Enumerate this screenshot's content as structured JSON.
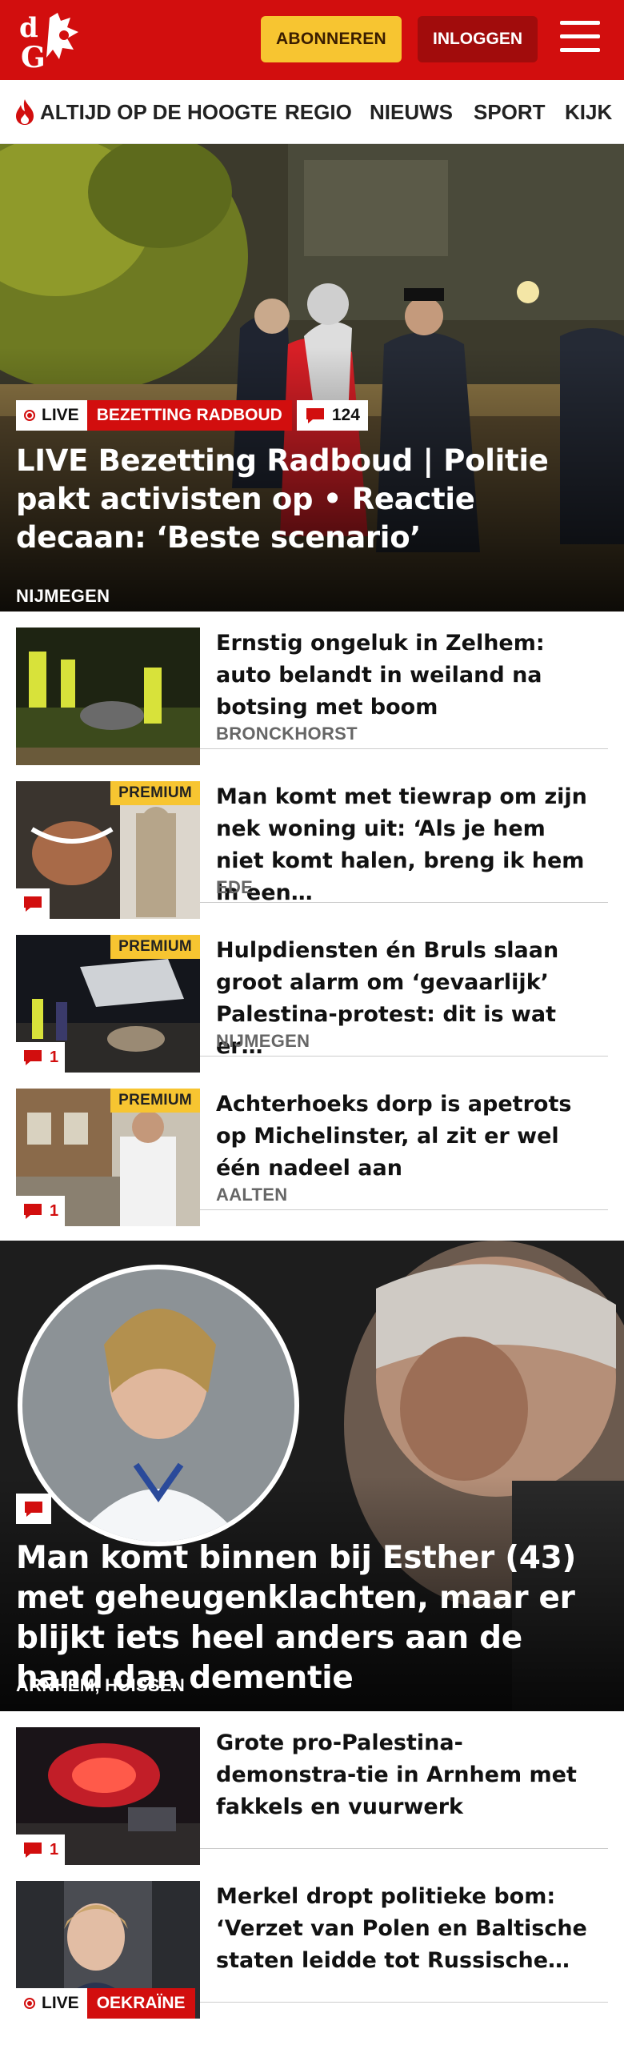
{
  "header": {
    "logo_text": "dG",
    "subscribe_label": "ABONNEREN",
    "login_label": "INLOGGEN",
    "menu_icon": "hamburger-icon"
  },
  "nav": {
    "items": [
      "ALTIJD OP DE HOOGTE",
      "REGIO",
      "NIEUWS",
      "SPORT",
      "KIJK"
    ]
  },
  "hero": {
    "live_label": "LIVE",
    "tag": "BEZETTING RADBOUD",
    "comment_count": "124",
    "title": "LIVE Bezetting Radboud | Politie pakt activisten op • Reactie decaan: ‘Beste scenario’",
    "location": "NIJMEGEN"
  },
  "articles": [
    {
      "title": "Ernstig ongeluk in Zelhem: auto belandt in weiland na botsing met boom",
      "location": "BRONCKHORST",
      "premium": "",
      "comments": ""
    },
    {
      "title": "Man komt met tiewrap om zijn nek woning uit: ‘Als je hem niet komt halen, breng ik hem in een…",
      "location": "EDE",
      "premium": "PREMIUM",
      "comments": ""
    },
    {
      "title": "Hulpdiensten én Bruls slaan groot alarm om ‘gevaarlijk’ Palestina-protest: dit is wat er…",
      "location": "NIJMEGEN",
      "premium": "PREMIUM",
      "comments": "1"
    },
    {
      "title": "Achterhoeks dorp is apetrots op Michelinster, al zit er wel één nadeel aan",
      "location": "AALTEN",
      "premium": "PREMIUM",
      "comments": "1"
    }
  ],
  "feature": {
    "title": "Man komt binnen bij Esther (43) met geheugenklachten, maar er blijkt iets heel anders aan de hand dan dementie",
    "location": "ARNHEM, HUISSEN"
  },
  "articles2": [
    {
      "title": "Grote pro-Palestina-demonstra-tie in Arnhem met fakkels en vuurwerk",
      "location": "",
      "comments": "1"
    },
    {
      "title": "Merkel dropt politieke bom: ‘Verzet van Polen en Baltische staten leidde tot Russische…",
      "location": "",
      "live_label": "LIVE",
      "tag": "OEKRAÏNE"
    }
  ],
  "colors": {
    "brand_red": "#d20e0e",
    "premium_yellow": "#f7c531",
    "dark_red": "#a10c0c"
  }
}
